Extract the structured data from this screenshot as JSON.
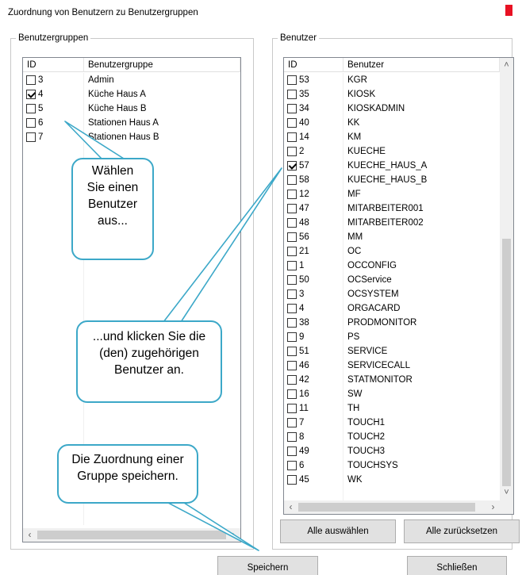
{
  "window": {
    "title": "Zuordnung von Benutzern zu Benutzergruppen"
  },
  "groups_panel": {
    "legend": "Benutzergruppen",
    "columns": {
      "id": "ID",
      "name": "Benutzergruppe"
    },
    "rows": [
      {
        "id": "3",
        "name": "Admin",
        "checked": false
      },
      {
        "id": "4",
        "name": "Küche Haus A",
        "checked": true
      },
      {
        "id": "5",
        "name": "Küche Haus B",
        "checked": false
      },
      {
        "id": "6",
        "name": "Stationen Haus A",
        "checked": false
      },
      {
        "id": "7",
        "name": "Stationen Haus B",
        "checked": false
      }
    ]
  },
  "users_panel": {
    "legend": "Benutzer",
    "columns": {
      "id": "ID",
      "name": "Benutzer"
    },
    "rows": [
      {
        "id": "53",
        "name": "KGR",
        "checked": false
      },
      {
        "id": "35",
        "name": "KIOSK",
        "checked": false
      },
      {
        "id": "34",
        "name": "KIOSKADMIN",
        "checked": false
      },
      {
        "id": "40",
        "name": "KK",
        "checked": false
      },
      {
        "id": "14",
        "name": "KM",
        "checked": false
      },
      {
        "id": "2",
        "name": "KUECHE",
        "checked": false
      },
      {
        "id": "57",
        "name": "KUECHE_HAUS_A",
        "checked": true
      },
      {
        "id": "58",
        "name": "KUECHE_HAUS_B",
        "checked": false
      },
      {
        "id": "12",
        "name": "MF",
        "checked": false
      },
      {
        "id": "47",
        "name": "MITARBEITER001",
        "checked": false
      },
      {
        "id": "48",
        "name": "MITARBEITER002",
        "checked": false
      },
      {
        "id": "56",
        "name": "MM",
        "checked": false
      },
      {
        "id": "21",
        "name": "OC",
        "checked": false
      },
      {
        "id": "1",
        "name": "OCCONFIG",
        "checked": false
      },
      {
        "id": "50",
        "name": "OCService",
        "checked": false
      },
      {
        "id": "3",
        "name": "OCSYSTEM",
        "checked": false
      },
      {
        "id": "4",
        "name": "ORGACARD",
        "checked": false
      },
      {
        "id": "38",
        "name": "PRODMONITOR",
        "checked": false
      },
      {
        "id": "9",
        "name": "PS",
        "checked": false
      },
      {
        "id": "51",
        "name": "SERVICE",
        "checked": false
      },
      {
        "id": "46",
        "name": "SERVICECALL",
        "checked": false
      },
      {
        "id": "42",
        "name": "STATMONITOR",
        "checked": false
      },
      {
        "id": "16",
        "name": "SW",
        "checked": false
      },
      {
        "id": "11",
        "name": "TH",
        "checked": false
      },
      {
        "id": "7",
        "name": "TOUCH1",
        "checked": false
      },
      {
        "id": "8",
        "name": "TOUCH2",
        "checked": false
      },
      {
        "id": "49",
        "name": "TOUCH3",
        "checked": false
      },
      {
        "id": "6",
        "name": "TOUCHSYS",
        "checked": false
      },
      {
        "id": "45",
        "name": "WK",
        "checked": false
      }
    ],
    "select_all_label": "Alle auswählen",
    "reset_all_label": "Alle zurücksetzen"
  },
  "footer": {
    "save_label": "Speichern",
    "close_label": "Schließen"
  },
  "callouts": {
    "choose_user": "Wählen Sie einen Benutzer aus...",
    "click_users": "...und klicken Sie die (den) zugehörigen Benutzer an.",
    "save_assignment": "Die Zuordnung einer Gruppe speichern."
  },
  "icons": {
    "scroll_left": "chevron-left-icon",
    "scroll_right": "chevron-right-icon",
    "scroll_up": "chevron-up-icon",
    "scroll_down": "chevron-down-icon"
  },
  "colors": {
    "callout_border": "#3ca8c8",
    "close_button": "#e81123"
  }
}
